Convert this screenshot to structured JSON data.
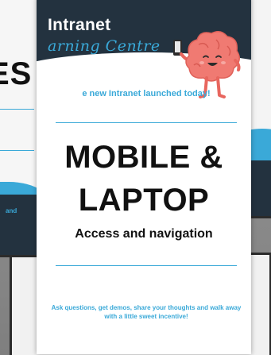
{
  "back_card_left": {
    "big_text": "ES",
    "small_text": "and"
  },
  "poster": {
    "header": {
      "title": "Intranet",
      "subtitle": "arning Centre"
    },
    "mascot": "brain-mascot-icon",
    "announcement": "e new Intranet launched today!",
    "headline_line1": "MOBILE &",
    "headline_line2": "LAPTOP",
    "subheadline": "Access and navigation",
    "footer_text": "Ask questions, get demos, share your thoughts and walk away with a little sweet incentive!"
  },
  "colors": {
    "navy": "#23323f",
    "accent_blue": "#3aa9d8",
    "brain_pink": "#f07a72"
  }
}
